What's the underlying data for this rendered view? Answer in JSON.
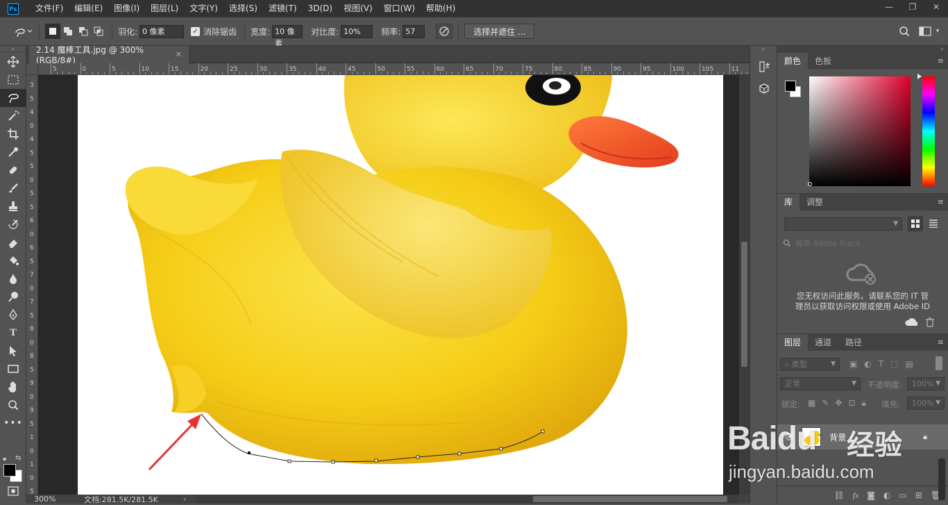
{
  "app": {
    "logo": "Ps"
  },
  "menu": [
    "文件(F)",
    "编辑(E)",
    "图像(I)",
    "图层(L)",
    "文字(Y)",
    "选择(S)",
    "滤镜(T)",
    "3D(D)",
    "视图(V)",
    "窗口(W)",
    "帮助(H)"
  ],
  "window": {
    "minimize": "—",
    "restore": "❐",
    "close": "✕"
  },
  "options": {
    "feather_label": "羽化:",
    "feather_value": "0 像素",
    "antialias_label": "消除锯齿",
    "width_label": "宽度:",
    "width_value": "10 像素",
    "contrast_label": "对比度:",
    "contrast_value": "10%",
    "frequency_label": "频率:",
    "frequency_value": "57",
    "select_mask_label": "选择并遮住 ..."
  },
  "document": {
    "tab_title": "2.14 魔棒工具.jpg @ 300%(RGB/8#)",
    "close": "✕",
    "zoom": "300%",
    "doc_info": "文档:281.5K/281.5K"
  },
  "ruler_top": [
    "5",
    "0",
    "5",
    "10",
    "15",
    "20",
    "25",
    "30",
    "35",
    "40",
    "45",
    "50",
    "55",
    "60",
    "65",
    "70",
    "75",
    "80",
    "85",
    "90",
    "95",
    "100",
    "105",
    "11"
  ],
  "ruler_left": [
    "3",
    "5",
    "4",
    "0",
    "4",
    "5",
    "5",
    "0",
    "5",
    "5",
    "6",
    "0",
    "6",
    "5",
    "7",
    "0",
    "7",
    "5",
    "8",
    "0",
    "8",
    "5",
    "9",
    "0",
    "9",
    "5",
    "1",
    "0",
    "1",
    "0",
    "5"
  ],
  "panels": {
    "color_tabs": [
      "颜色",
      "色板"
    ],
    "library_tabs": [
      "库",
      "调整"
    ],
    "library_search_placeholder": "搜索 Adobe Stock",
    "library_message_line1": "您无权访问此服务。请联系您的 IT 管",
    "library_message_line2": "理员以获取访问权限或使用 Adobe ID",
    "layers_tabs": [
      "图层",
      "通道",
      "路径"
    ],
    "layer_filter": "类型",
    "blend_mode": "正常",
    "opacity_label": "不透明度:",
    "opacity_value": "100%",
    "lock_label": "锁定:",
    "fill_label": "填充:",
    "fill_value": "100%",
    "layer_name": "背景"
  },
  "watermark": {
    "brand": "Baidu",
    "product": "经验",
    "url": "jingyan.baidu.com"
  },
  "colors": {
    "accent": "#31a8ff",
    "menubar": "#323232",
    "panel": "#535353",
    "duck": "#f7d21e",
    "beak": "#f2552c",
    "arrow": "#e8322c"
  }
}
